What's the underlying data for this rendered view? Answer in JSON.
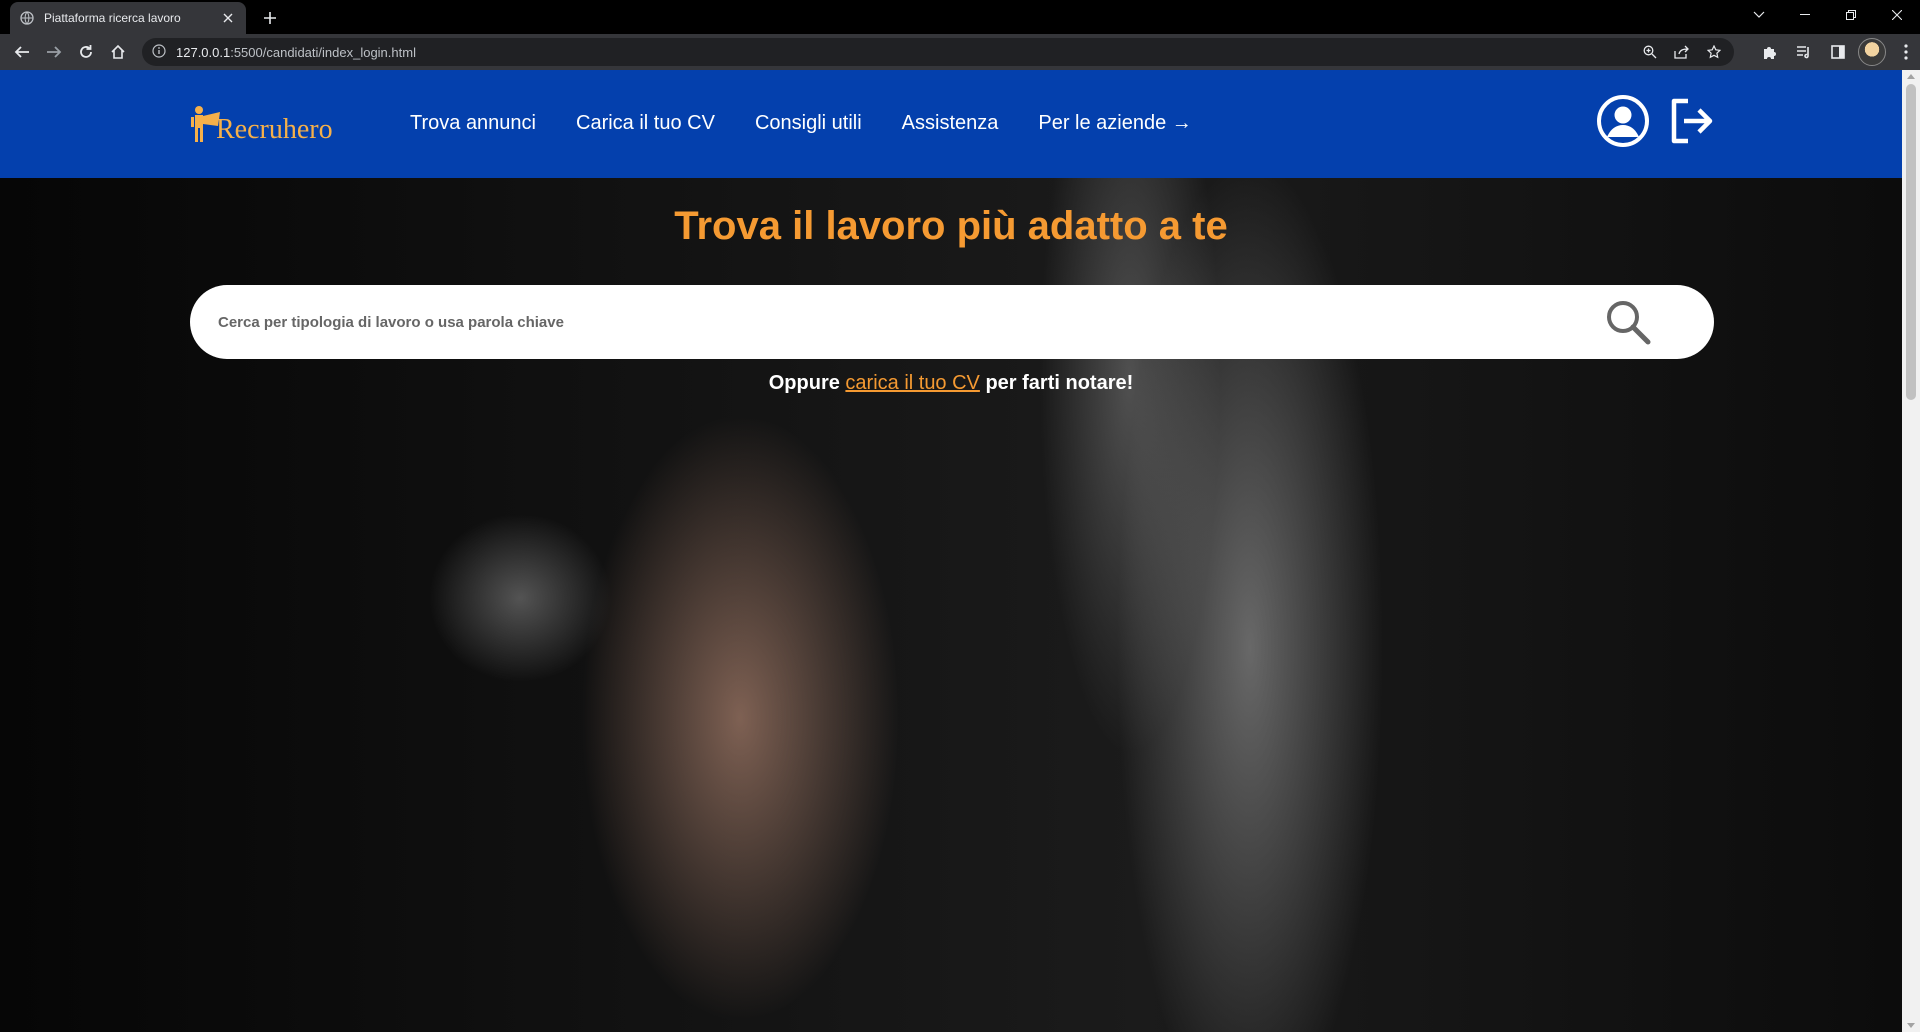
{
  "browser": {
    "tab_title": "Piattaforma ricerca lavoro",
    "url_host": "127.0.0.1",
    "url_rest": ":5500/candidati/index_login.html"
  },
  "site": {
    "logo_text": "Recruhero",
    "nav": [
      {
        "label": "Trova annunci"
      },
      {
        "label": "Carica il tuo CV"
      },
      {
        "label": "Consigli utili"
      },
      {
        "label": "Assistenza"
      },
      {
        "label": "Per le aziende →"
      }
    ],
    "brand_color": "#0440ad",
    "accent_color": "#f59a32"
  },
  "hero": {
    "title": "Trova il lavoro più adatto a te",
    "search_placeholder": "Cerca per tipologia di lavoro o usa parola chiave",
    "cta_prefix": "Oppure ",
    "cta_link": "carica il tuo CV",
    "cta_suffix": " per farti notare!"
  }
}
